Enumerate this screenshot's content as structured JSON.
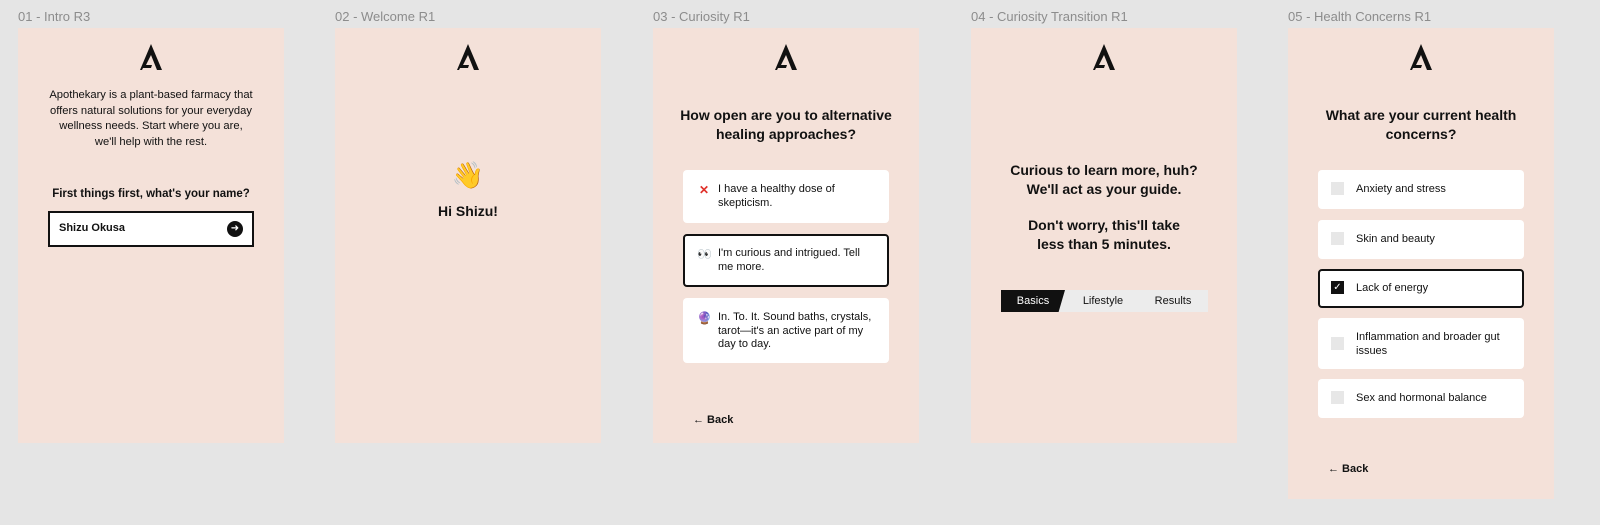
{
  "frames": {
    "f1": {
      "label": "01 - Intro R3",
      "intro": "Apothekary is a plant-based farmacy that offers natural solutions for your everyday wellness needs. Start where you are, we'll help with the rest.",
      "ask": "First things first, what's your name?",
      "name_value": "Shizu Okusa",
      "submit_icon": "arrow-right-circle-icon"
    },
    "f2": {
      "label": "02 - Welcome R1",
      "wave": "👋",
      "greeting": "Hi Shizu!"
    },
    "f3": {
      "label": "03 - Curiosity R1",
      "question": "How open are you to alternative healing approaches?",
      "options": [
        {
          "icon": "✕",
          "text": "I have a healthy dose of skepticism."
        },
        {
          "icon": "👀",
          "text": "I'm curious and intrigued. Tell me more."
        },
        {
          "icon": "🔮",
          "text": "In. To. It. Sound baths, crystals, tarot—it's an active part of my day to day."
        }
      ],
      "selected_index": 1,
      "back": "← Back"
    },
    "f4": {
      "label": "04 - Curiosity Transition R1",
      "line1": "Curious to learn more, huh?",
      "line2": "We'll act as your guide.",
      "line3": "Don't worry, this'll take",
      "line4": "less than 5 minutes.",
      "steps": [
        "Basics",
        "Lifestyle",
        "Results"
      ],
      "active_step": 0
    },
    "f5": {
      "label": "05 - Health Concerns R1",
      "question": "What are your current health concerns?",
      "options": [
        {
          "text": "Anxiety and stress",
          "checked": false
        },
        {
          "text": "Skin and beauty",
          "checked": false
        },
        {
          "text": "Lack of energy",
          "checked": true
        },
        {
          "text": "Inflammation and broader gut issues",
          "checked": false
        },
        {
          "text": "Sex and hormonal balance",
          "checked": false
        }
      ],
      "back": "← Back"
    }
  },
  "colors": {
    "frame_bg": "#f4e1d9",
    "canvas_bg": "#e5e5e5",
    "accent": "#111111",
    "error_red": "#e0302a"
  }
}
